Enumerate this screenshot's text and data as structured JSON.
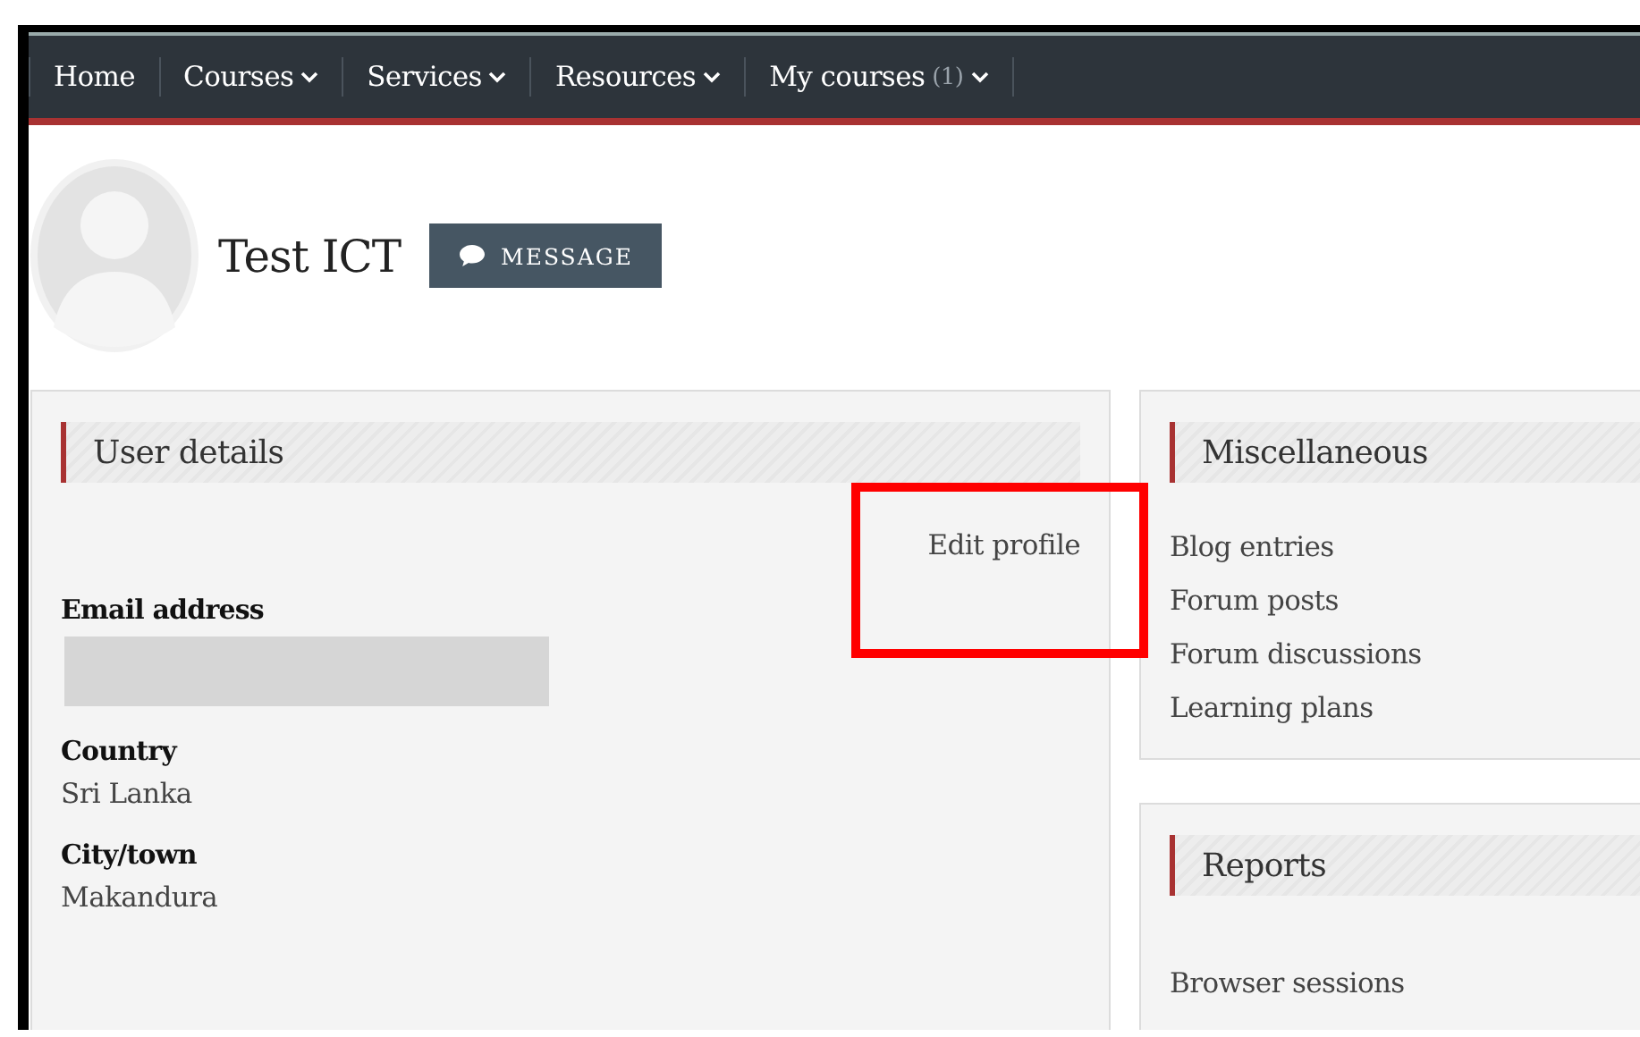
{
  "navbar": {
    "items": [
      {
        "label": "Home",
        "dropdown": false
      },
      {
        "label": "Courses",
        "dropdown": true
      },
      {
        "label": "Services",
        "dropdown": true
      },
      {
        "label": "Resources",
        "dropdown": true
      },
      {
        "label": "My courses",
        "count": "(1)",
        "dropdown": true
      }
    ]
  },
  "profile": {
    "name": "Test ICT",
    "message_button": "MESSAGE"
  },
  "user_details": {
    "title": "User details",
    "edit_link": "Edit profile",
    "highlighted": true,
    "fields": [
      {
        "label": "Email address",
        "redacted": true
      },
      {
        "label": "Country",
        "value": "Sri Lanka"
      },
      {
        "label": "City/town",
        "value": "Makandura"
      }
    ]
  },
  "miscellaneous": {
    "title": "Miscellaneous",
    "links": [
      "Blog entries",
      "Forum posts",
      "Forum discussions",
      "Learning plans"
    ]
  },
  "reports": {
    "title": "Reports",
    "links": [
      "Browser sessions"
    ]
  }
}
